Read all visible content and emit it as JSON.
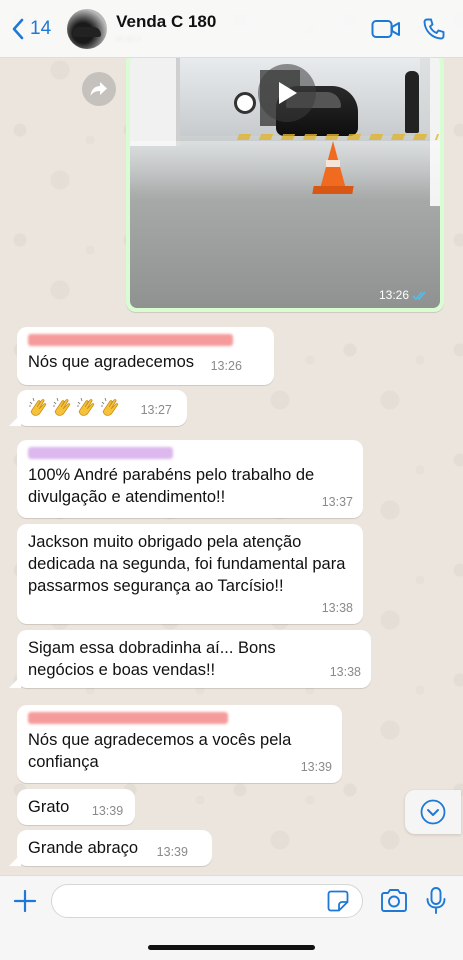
{
  "header": {
    "back_count": "14",
    "title": "Venda C 180",
    "subtitle": "·· ·· ·"
  },
  "media_message": {
    "time": "13:26",
    "status": "read"
  },
  "messages": [
    {
      "text": "Nós que agradecemos",
      "time": "13:26"
    },
    {
      "emoji": [
        "clapping-hands",
        "clapping-hands",
        "clapping-hands",
        "clapping-hands"
      ],
      "time": "13:27"
    },
    {
      "text": "100% André parabéns pelo trabalho de divulgação e atendimento!!",
      "time": "13:37"
    },
    {
      "text": "Jackson muito obrigado pela atenção dedicada na segunda, foi fundamental para passarmos segurança ao Tarcísio!!",
      "time": "13:38"
    },
    {
      "text": "Sigam essa dobradinha aí... Bons negócios e boas vendas!!",
      "time": "13:38"
    },
    {
      "text": "Nós que agradecemos a vocês pela confiança",
      "time": "13:39"
    },
    {
      "text": "Grato",
      "time": "13:39"
    },
    {
      "text": "Grande abraço",
      "time": "13:39"
    }
  ],
  "composer": {
    "placeholder": ""
  },
  "colors": {
    "accent": "#1e79d6",
    "outgoing_bubble": "#d9fdd3",
    "incoming_bubble": "#ffffff",
    "read_ticks": "#53bdeb"
  },
  "icons": [
    "chevron-left-icon",
    "video-call-icon",
    "phone-icon",
    "play-icon",
    "forward-icon",
    "double-check-icon",
    "chevron-down-icon",
    "plus-icon",
    "sticker-icon",
    "camera-icon",
    "microphone-icon"
  ]
}
